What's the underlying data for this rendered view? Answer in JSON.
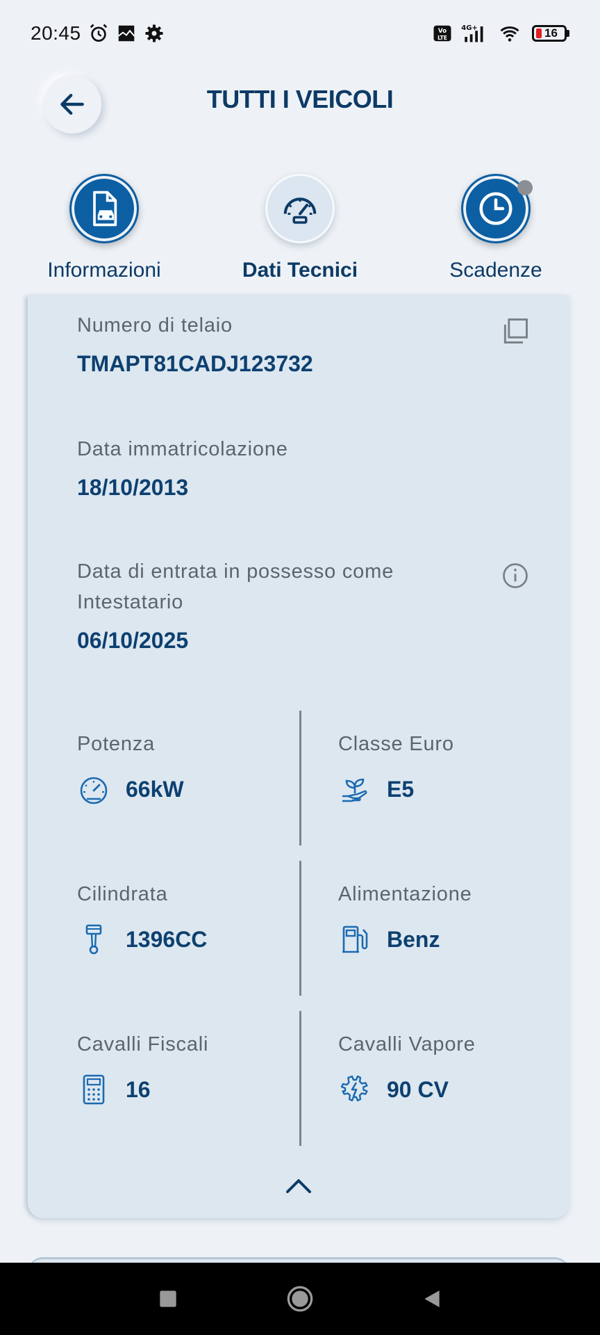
{
  "status_bar": {
    "time": "20:45",
    "battery": "16",
    "network": "4G+",
    "volte": "Vo LTE"
  },
  "header": {
    "title": "TUTTI I VEICOLI"
  },
  "tabs": [
    {
      "label": "Informazioni",
      "icon": "document-car-icon"
    },
    {
      "label": "Dati Tecnici",
      "icon": "speedometer-icon"
    },
    {
      "label": "Scadenze",
      "icon": "clock-icon"
    }
  ],
  "details": {
    "chassis": {
      "label": "Numero di telaio",
      "value": "TMAPT81CADJ123732"
    },
    "registration": {
      "label": "Data immatricolazione",
      "value": "18/10/2013"
    },
    "ownership": {
      "label_line1": "Data di entrata in possesso come",
      "label_line2": "Intestatario",
      "value": "06/10/2025"
    }
  },
  "specs": {
    "power": {
      "label": "Potenza",
      "value": "66kW",
      "icon": "gauge-icon"
    },
    "euro_class": {
      "label": "Classe Euro",
      "value": "E5",
      "icon": "eco-plant-icon"
    },
    "displacement": {
      "label": "Cilindrata",
      "value": "1396CC",
      "icon": "piston-icon"
    },
    "fuel": {
      "label": "Alimentazione",
      "value": "Benz",
      "icon": "fuel-pump-icon"
    },
    "fiscal_hp": {
      "label": "Cavalli Fiscali",
      "value": "16",
      "icon": "calculator-icon"
    },
    "hp": {
      "label": "Cavalli Vapore",
      "value": "90 CV",
      "icon": "engine-icon"
    }
  },
  "colors": {
    "primary": "#0d5fa3",
    "text_dark": "#0d3a66",
    "card_bg": "#dde7f0",
    "page_bg": "#eef2f6"
  }
}
